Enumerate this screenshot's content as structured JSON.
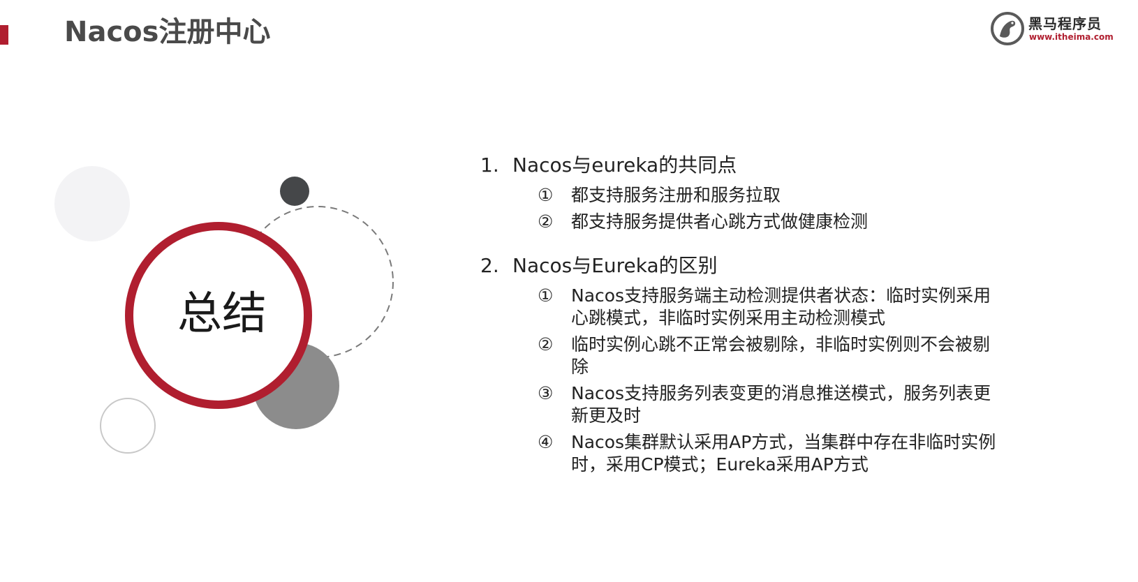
{
  "header": {
    "title": "Nacos注册中心"
  },
  "logo": {
    "name": "黑马程序员",
    "url": "www.itheima.com"
  },
  "summary_label": "总结",
  "sections": [
    {
      "number": "1.",
      "heading": "Nacos与eureka的共同点",
      "items": [
        {
          "marker": "①",
          "text": "都支持服务注册和服务拉取"
        },
        {
          "marker": "②",
          "text": "都支持服务提供者心跳方式做健康检测"
        }
      ]
    },
    {
      "number": "2.",
      "heading": "Nacos与Eureka的区别",
      "items": [
        {
          "marker": "①",
          "text": "Nacos支持服务端主动检测提供者状态：临时实例采用心跳模式，非临时实例采用主动检测模式"
        },
        {
          "marker": "②",
          "text": "临时实例心跳不正常会被剔除，非临时实例则不会被剔除"
        },
        {
          "marker": "③",
          "text": "Nacos支持服务列表变更的消息推送模式，服务列表更新更及时"
        },
        {
          "marker": "④",
          "text": "Nacos集群默认采用AP方式，当集群中存在非临时实例时，采用CP模式；Eureka采用AP方式"
        }
      ]
    }
  ],
  "colors": {
    "accent": "#b01e2f",
    "title_gray": "#4a4a4a",
    "dark_dot": "#454749",
    "gray_circle": "#8c8c8c",
    "light_circle": "#f3f3f5"
  }
}
